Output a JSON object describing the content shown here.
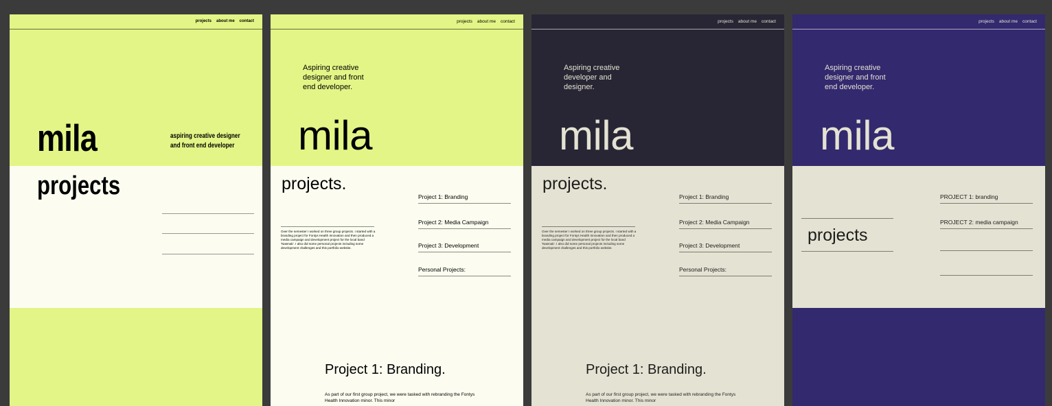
{
  "colors": {
    "background": "#3b3b3b",
    "lime": "#e3f586",
    "cream": "#fcfdf0",
    "dark": "#282634",
    "beige": "#e4e2d2",
    "indigo": "#33296e"
  },
  "nav": {
    "projects": "projects",
    "about": "about me",
    "contact": "contact"
  },
  "frame1": {
    "name": "mila",
    "tagline_1": "aspiring creative designer",
    "tagline_2": "and front end developer",
    "projects": "projects"
  },
  "frame2": {
    "intro": "Aspiring creative designer and front end developer.",
    "name": "mila",
    "projects": "projects.",
    "items": [
      "Project 1:  Branding",
      "Project 2:  Media Campaign",
      "Project 3: Development",
      "Personal Projects:"
    ],
    "blurb": "Over the semester I worked on three group projects. I started with a branding project for Fontys Health Innovation and then produced a media campaign and development project for the local band 'Nasmak'. I also did some personal projects including some development challenges and this portfolio website.",
    "p1_title": "Project 1: Branding.",
    "p1_body": "As part of our first group project, we were tasked with rebranding the Fontys Health Innovation minor. This minor"
  },
  "frame3": {
    "intro": "Aspiring creative developer and designer.",
    "name": "mila",
    "projects": "projects.",
    "items": [
      "Project 1:  Branding",
      "Project 2:  Media Campaign",
      "Project 3: Development",
      "Personal Projects:"
    ],
    "blurb": "Over the semester I worked on three group projects. I started with a branding project for Fontys Health Innovation and then produced a media campaign and development project for the local band 'Nasmak'. I also did some personal projects including some development challenges and this portfolio website.",
    "p1_title": "Project 1: Branding.",
    "p1_body": "As part of our first group project, we were tasked with rebranding the Fontys Health Innovation minor. This minor"
  },
  "frame4": {
    "intro": "Aspiring creative designer and front end developer.",
    "name": "mila",
    "projects": "projects",
    "items": [
      "PROJECT 1: branding",
      "PROJECT 2: media campaign"
    ]
  }
}
